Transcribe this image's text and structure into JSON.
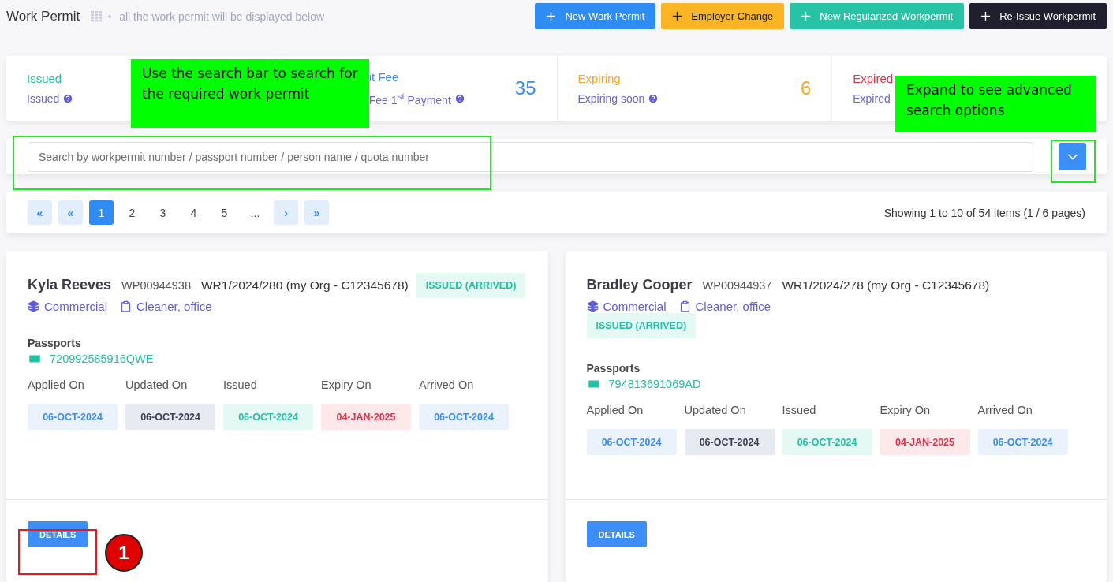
{
  "header": {
    "title": "Work Permit",
    "subtitle": "all the work permit will be displayed below",
    "buttons": [
      {
        "label": "New Work Permit",
        "kind": "primary"
      },
      {
        "label": "Employer Change",
        "kind": "warning"
      },
      {
        "label": "New Regularized Workpermit",
        "kind": "success"
      },
      {
        "label": "Re-Issue Workpermit",
        "kind": "dark"
      }
    ]
  },
  "stats": [
    {
      "title": "Issued",
      "subtitle": "Issued",
      "color": "#26bfa3"
    },
    {
      "title": "it Fee",
      "subtitle": "Fee 1$^{st}$ Payment",
      "value": "35",
      "color": "#3b8cf3"
    },
    {
      "title": "Expiring",
      "subtitle": "Expiring soon",
      "value": "6",
      "color": "#f9a825"
    },
    {
      "title": "Expired",
      "subtitle": "Expired",
      "color": "#e0334c"
    }
  ],
  "search": {
    "placeholder": "Search by workpermit number / passport number / person name / quota number"
  },
  "pagination": {
    "pages": [
      {
        "label": "«",
        "kind": "nav",
        "selected": false
      },
      {
        "label": "«",
        "kind": "nav",
        "selected": false
      },
      {
        "label": "1",
        "kind": "page",
        "selected": true
      },
      {
        "label": "2",
        "kind": "page",
        "selected": false
      },
      {
        "label": "3",
        "kind": "page",
        "selected": false
      },
      {
        "label": "4",
        "kind": "page",
        "selected": false
      },
      {
        "label": "5",
        "kind": "page",
        "selected": false
      },
      {
        "label": "...",
        "kind": "page",
        "selected": false
      },
      {
        "label": "›",
        "kind": "nav",
        "selected": false
      },
      {
        "label": "»",
        "kind": "nav",
        "selected": false
      }
    ],
    "summary": "Showing 1 to 10 of 54 items (1 / 6 pages)"
  },
  "cards": [
    {
      "name": "Kyla Reeves",
      "permit_number": "WP00944938",
      "reference": "WR1/2024/280",
      "org": "(my Org - C12345678)",
      "status": "ISSUED (ARRIVED)",
      "category": "Commercial",
      "occupation": "Cleaner, office",
      "passports_label": "Passports",
      "passport": "720992585916QWE",
      "dates": [
        {
          "label": "Applied On",
          "value": "06-OCT-2024",
          "kind": "applied"
        },
        {
          "label": "Updated On",
          "value": "06-OCT-2024",
          "kind": "updated"
        },
        {
          "label": "Issued",
          "value": "06-OCT-2024",
          "kind": "issued"
        },
        {
          "label": "Expiry On",
          "value": "04-JAN-2025",
          "kind": "expiry"
        },
        {
          "label": "Arrived On",
          "value": "06-OCT-2024",
          "kind": "arrived"
        }
      ],
      "button": "DETAILS",
      "highlighted": true
    },
    {
      "name": "Bradley Cooper",
      "permit_number": "WP00944937",
      "reference": "WR1/2024/278",
      "org": "(my Org - C12345678)",
      "status": "ISSUED (ARRIVED)",
      "category": "Commercial",
      "occupation": "Cleaner, office",
      "passports_label": "Passports",
      "passport": "794813691069AD",
      "dates": [
        {
          "label": "Applied On",
          "value": "06-OCT-2024",
          "kind": "applied"
        },
        {
          "label": "Updated On",
          "value": "06-OCT-2024",
          "kind": "updated"
        },
        {
          "label": "Issued",
          "value": "06-OCT-2024",
          "kind": "issued"
        },
        {
          "label": "Expiry On",
          "value": "04-JAN-2025",
          "kind": "expiry"
        },
        {
          "label": "Arrived On",
          "value": "06-OCT-2024",
          "kind": "arrived"
        }
      ],
      "button": "DETAILS",
      "highlighted": false
    }
  ],
  "annotations": {
    "search_callout": "Use the search bar to search for the required work permit",
    "expand_callout": "Expand to see advanced search options",
    "step_marker": "1"
  }
}
